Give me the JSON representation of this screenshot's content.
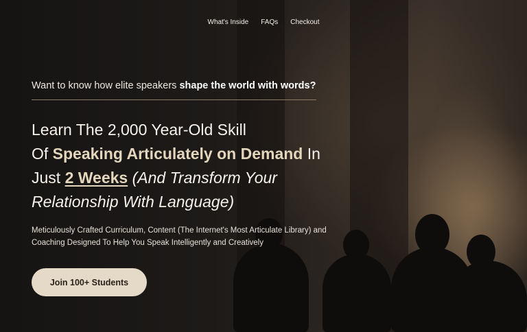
{
  "nav": {
    "items": [
      {
        "label": "What's Inside"
      },
      {
        "label": "FAQs"
      },
      {
        "label": "Checkout"
      }
    ]
  },
  "hero": {
    "kicker_plain": "Want to know how elite speakers ",
    "kicker_bold": "shape the world with words?",
    "headline": {
      "line1": "Learn The 2,000 Year-Old Skill",
      "line2_prefix": "Of ",
      "line2_accent": "Speaking Articulately on Demand",
      "line2_suffix": " In",
      "line3_prefix": "Just ",
      "line3_underlined": "2 Weeks",
      "line3_italic": " (And Transform Your",
      "line4_italic": "Relationship With Language)"
    },
    "subtext_line1": "Meticulously Crafted Curriculum, Content (The Internet's Most Articulate Library) and",
    "subtext_line2": "Coaching Designed To Help You Speak Intelligently and Creatively",
    "cta_label": "Join 100+ Students"
  },
  "colors": {
    "background": "#1b1816",
    "accent_text": "#e3d6bd",
    "cta_background": "#e5dac7",
    "cta_text": "#2a221b",
    "divider": "#8c7a62"
  }
}
